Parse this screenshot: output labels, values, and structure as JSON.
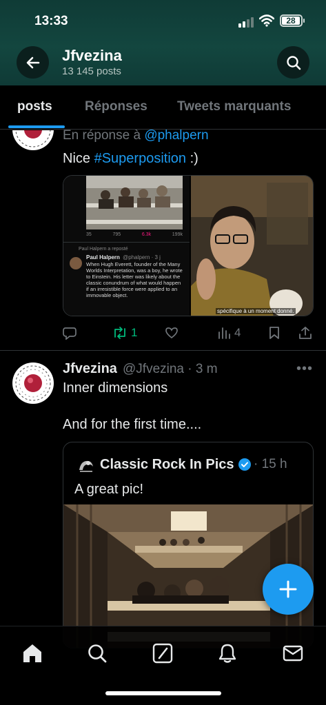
{
  "status_bar": {
    "time": "13:33",
    "battery": "28"
  },
  "header": {
    "name": "Jfvezina",
    "post_count": "13 145 posts"
  },
  "tabs": [
    {
      "label": "posts",
      "active": true
    },
    {
      "label": "Réponses",
      "active": false
    },
    {
      "label": "Tweets marquants",
      "active": false
    }
  ],
  "post1": {
    "reply_prefix": "En réponse à ",
    "reply_mention": "@phalpern",
    "text_prefix": "Nice ",
    "hashtag": "#Superposition",
    "text_suffix": " :)",
    "embedded_tweet": {
      "stats": [
        "35",
        "795",
        "6.3k",
        "199k"
      ],
      "repost_line": "Paul Halpern a reposté",
      "author": "Paul Halpern",
      "handle": "@phalpern · 3 j",
      "body": "When Hugh Everett, founder of the Many Worlds Interpretation, was a boy, he wrote to Einstein. His letter was likely about the classic conundrum of what would happen if an irresistible force were applied to an immovable object."
    },
    "video_subtitle": "spécifique à un moment donné.",
    "actions": {
      "reposts": "1",
      "views": "4"
    }
  },
  "post2": {
    "author": "Jfvezina",
    "handle_time": "@Jfvezina · 3 m",
    "line1": "Inner dimensions",
    "line2": "And for the first time....",
    "quote": {
      "name": "Classic Rock In Pics",
      "time": "· 15 h",
      "text": "A great pic!"
    }
  },
  "colors": {
    "accent": "#1d9bf0",
    "repost_green": "#00ba7c",
    "like_pink": "#f91880",
    "header_teal": "#13463f"
  },
  "icons": {
    "back": "arrow-left-icon",
    "search": "search-icon",
    "reply": "chat-bubble-icon",
    "repost": "repost-icon",
    "like": "heart-icon",
    "views": "bar-chart-icon",
    "bookmark": "bookmark-icon",
    "share": "share-icon",
    "compose": "plus-icon",
    "nav": [
      "home-icon",
      "search-icon",
      "grok-icon",
      "bell-icon",
      "mail-icon"
    ]
  }
}
